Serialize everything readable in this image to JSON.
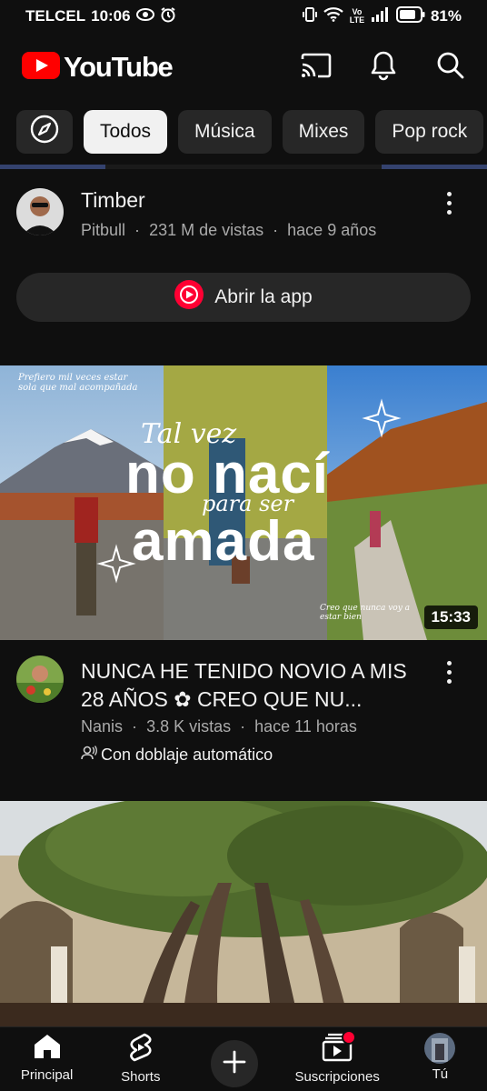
{
  "status_bar": {
    "carrier": "TELCEL",
    "time": "10:06",
    "network": "Vo LTE",
    "battery": "81%"
  },
  "header": {
    "brand": "YouTube",
    "icons": [
      "cast-icon",
      "bell-icon",
      "search-icon"
    ]
  },
  "chips": {
    "items": [
      "Todos",
      "Música",
      "Mixes",
      "Pop rock"
    ],
    "selected": "Todos"
  },
  "feed": {
    "video1": {
      "title": "Timber",
      "channel": "Pitbull",
      "views": "231 M de vistas",
      "age": "hace 9 años",
      "separator": "·",
      "open_app_label": "Abrir la app"
    },
    "video2": {
      "thumb_text_small": "Tal vez",
      "thumb_text_big1": "no nací",
      "thumb_text_mid": "para ser",
      "thumb_text_big2": "amada",
      "thumb_note_left": "Prefiero mil veces estar sola que mal acompañada",
      "thumb_note_right": "Creo que nunca voy a estar bien",
      "duration": "15:33",
      "title": "NUNCA HE TENIDO NOVIO A MIS 28 AÑOS ✿ CREO QUE NU...",
      "channel": "Nanis",
      "views": "3.8 K vistas",
      "age": "hace 11 horas",
      "separator": "·",
      "dubbing": "Con doblaje automático"
    }
  },
  "bottom_nav": {
    "home": "Principal",
    "shorts": "Shorts",
    "subscriptions": "Suscripciones",
    "you": "Tú"
  },
  "colors": {
    "background": "#0f0f0f",
    "brand_red": "#ff0000",
    "chip_bg": "#272727",
    "progress_blue": "#3a4a7a"
  }
}
